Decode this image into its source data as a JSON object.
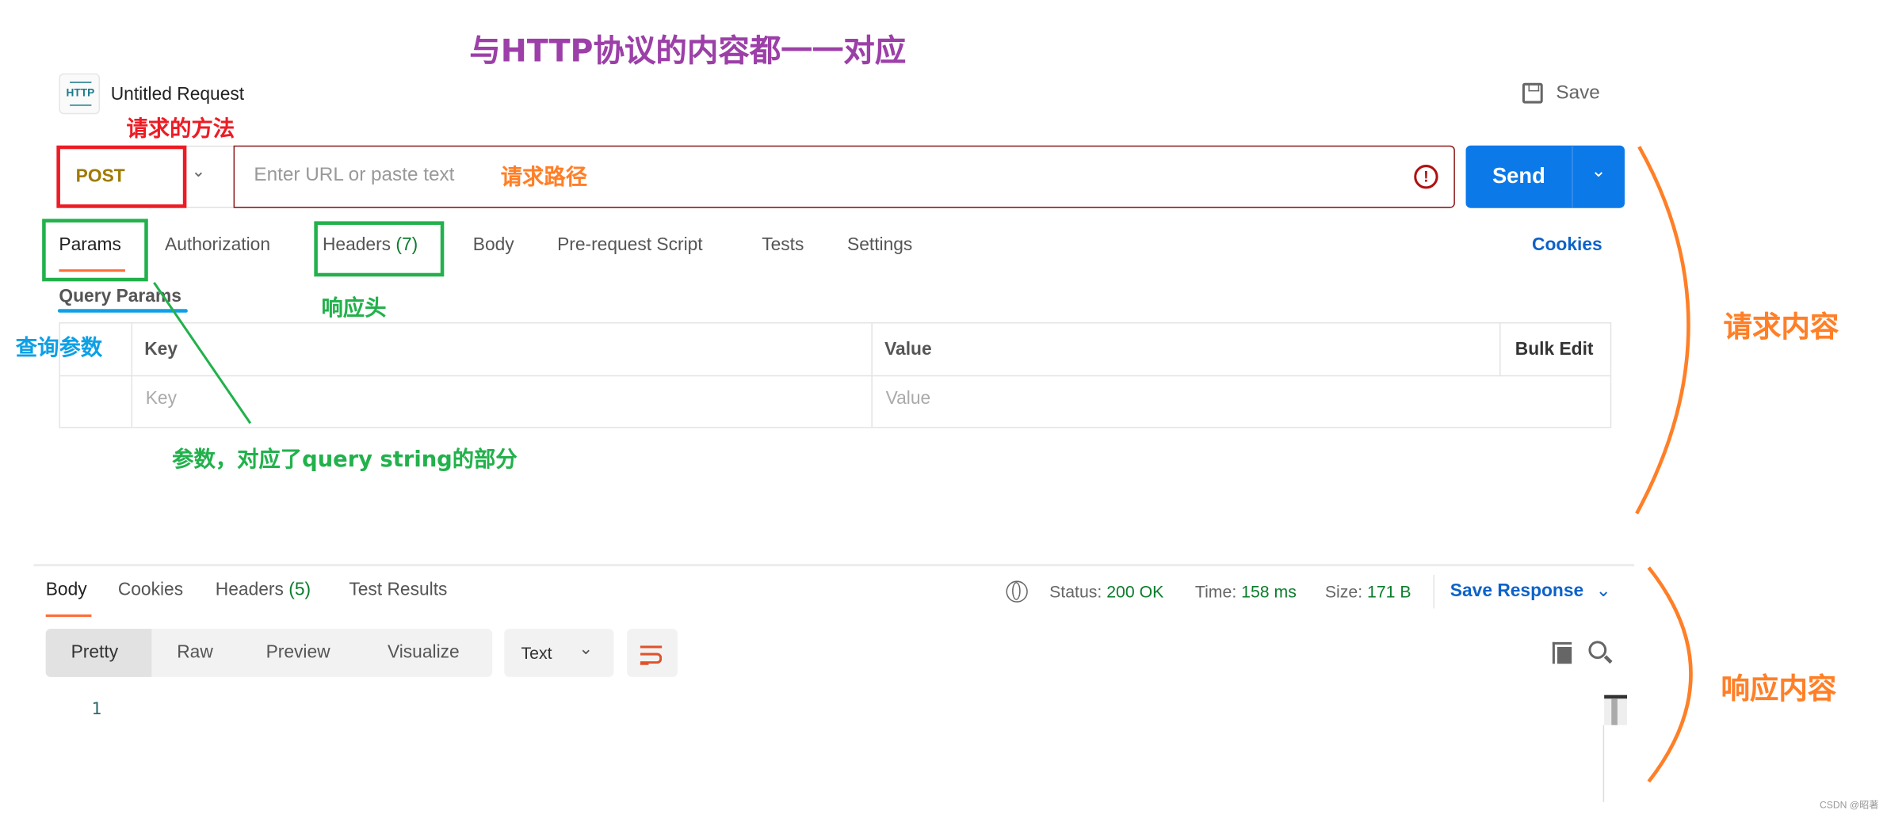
{
  "annotations": {
    "title": "与HTTP协议的内容都一一对应",
    "method": "请求的方法",
    "url": "请求路径",
    "headers": "响应头",
    "query": "查询参数",
    "params_note": "参数，对应了query string的部分",
    "request_content": "请求内容",
    "response_content": "响应内容",
    "colors": {
      "purple": "#9c3fa8",
      "red": "#ed1c24",
      "orange": "#ff7f27",
      "green": "#22b14c",
      "blue": "#0ea0e6"
    }
  },
  "header": {
    "icon": "http-icon",
    "icon_text": "HTTP",
    "title": "Untitled Request",
    "save_label": "Save"
  },
  "request": {
    "method": "POST",
    "url_placeholder": "Enter URL or paste text",
    "send_label": "Send",
    "tabs": [
      {
        "label": "Params",
        "active": true
      },
      {
        "label": "Authorization"
      },
      {
        "label": "Headers",
        "count": "(7)"
      },
      {
        "label": "Body"
      },
      {
        "label": "Pre-request Script"
      },
      {
        "label": "Tests"
      },
      {
        "label": "Settings"
      }
    ],
    "cookies_label": "Cookies",
    "subtab": "Query Params",
    "table": {
      "headers": [
        "Key",
        "Value",
        "Bulk Edit"
      ],
      "placeholders": [
        "Key",
        "Value"
      ]
    }
  },
  "response": {
    "tabs": [
      {
        "label": "Body",
        "active": true
      },
      {
        "label": "Cookies"
      },
      {
        "label": "Headers",
        "count": "(5)"
      },
      {
        "label": "Test Results"
      }
    ],
    "status_label": "Status:",
    "status_value": "200 OK",
    "time_label": "Time:",
    "time_value": "158 ms",
    "size_label": "Size:",
    "size_value": "171 B",
    "save_response": "Save Response",
    "views": [
      "Pretty",
      "Raw",
      "Preview",
      "Visualize"
    ],
    "active_view": "Pretty",
    "format": "Text",
    "line_numbers": [
      "1"
    ],
    "accent": "#0c79e8"
  },
  "watermark": "CSDN @昭著"
}
